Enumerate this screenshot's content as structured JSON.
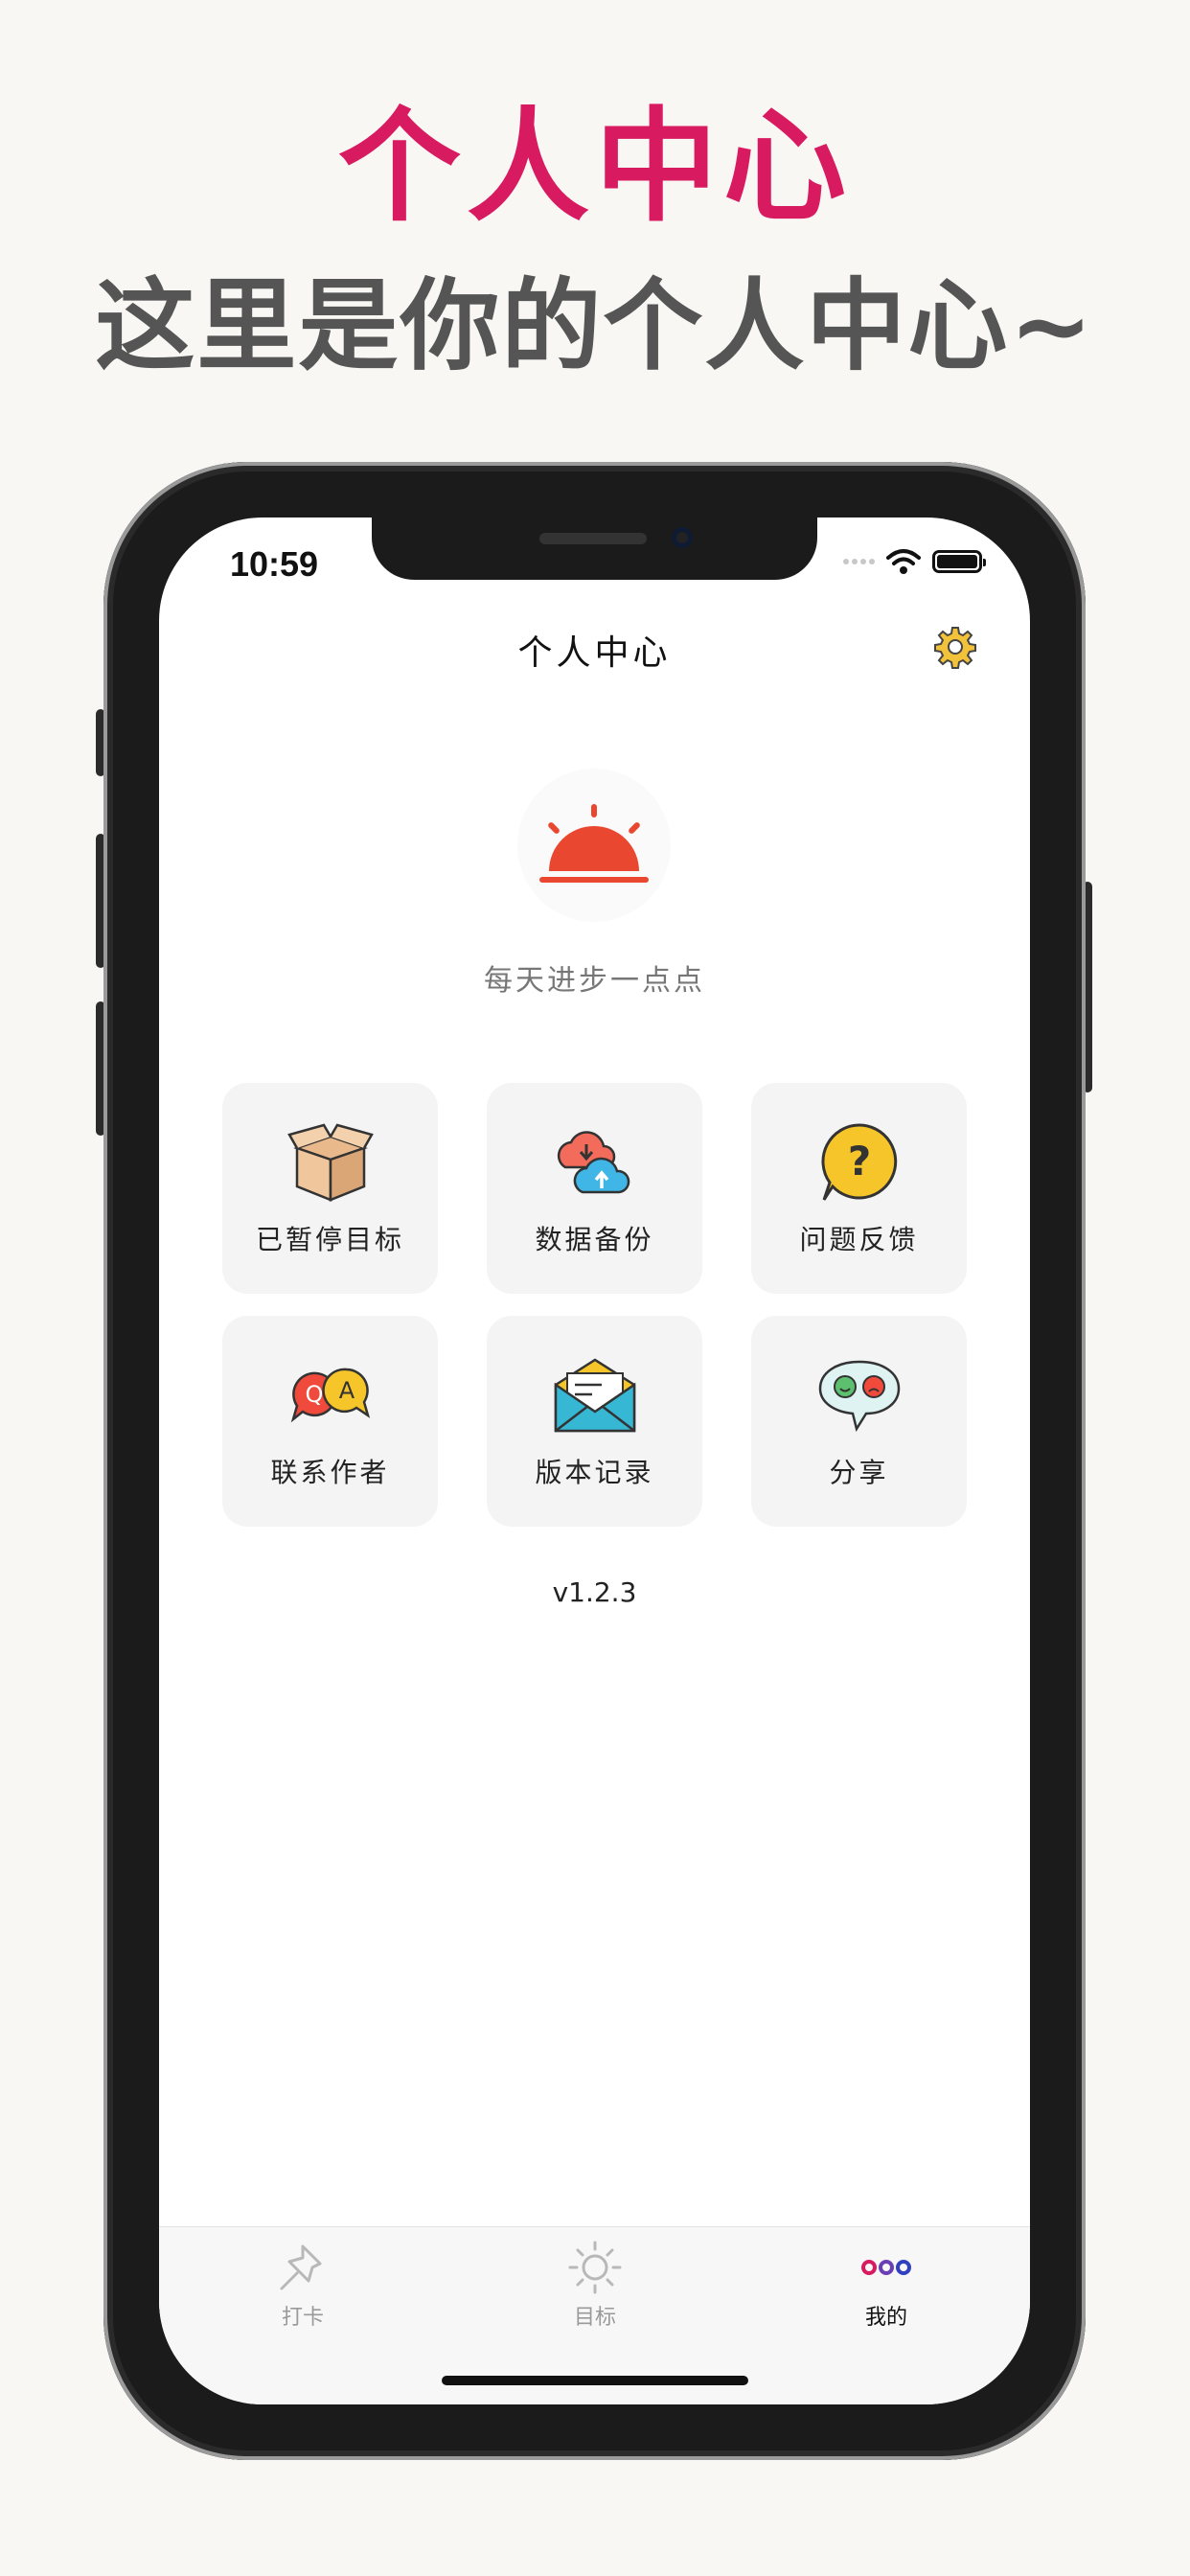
{
  "promo": {
    "title": "个人中心",
    "subtitle": "这里是你的个人中心~"
  },
  "status": {
    "time": "10:59"
  },
  "header": {
    "title": "个人中心"
  },
  "profile": {
    "motto": "每天进步一点点"
  },
  "menu": [
    {
      "label": "已暂停目标",
      "icon": "box-icon"
    },
    {
      "label": "数据备份",
      "icon": "cloud-sync-icon"
    },
    {
      "label": "问题反馈",
      "icon": "question-icon"
    },
    {
      "label": "联系作者",
      "icon": "qa-bubbles-icon"
    },
    {
      "label": "版本记录",
      "icon": "envelope-icon"
    },
    {
      "label": "分享",
      "icon": "emoji-bubble-icon"
    }
  ],
  "version": "v1.2.3",
  "tabs": [
    {
      "label": "打卡",
      "icon": "pin-icon"
    },
    {
      "label": "目标",
      "icon": "sun-icon"
    },
    {
      "label": "我的",
      "icon": "three-dots-icon"
    }
  ],
  "colors": {
    "accent": "#d81b60",
    "subtitle": "#555555",
    "tile_bg": "#f4f4f4"
  }
}
